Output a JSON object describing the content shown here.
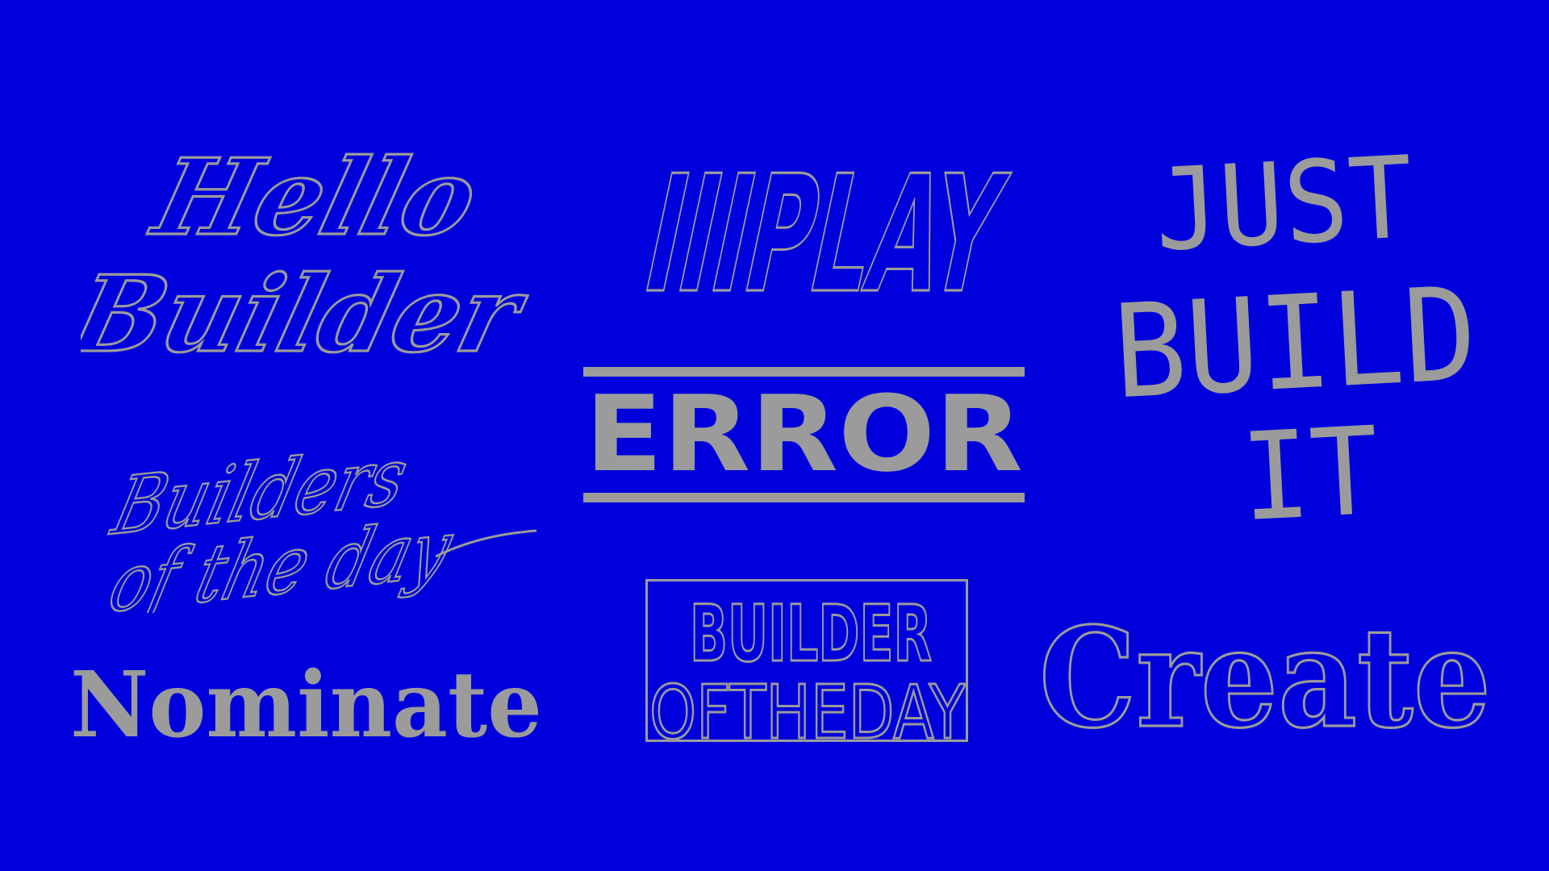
{
  "colors": {
    "background": "#0000dc",
    "ink": "#9b9b9b"
  },
  "wordmarks": {
    "hello_line1": "Hello",
    "hello_line2": "Builder",
    "iiplay": "IIIPLAY",
    "error": "ERROR",
    "just_line1": "JUST",
    "just_line2": "BUILD",
    "just_line3": "IT",
    "builders_line1": "Builders",
    "builders_line2": "of the day",
    "nominate": "Nominate",
    "builder_box_line1": "BUILDER",
    "builder_box_line2": "OFTHEDAY",
    "create": "Create"
  }
}
